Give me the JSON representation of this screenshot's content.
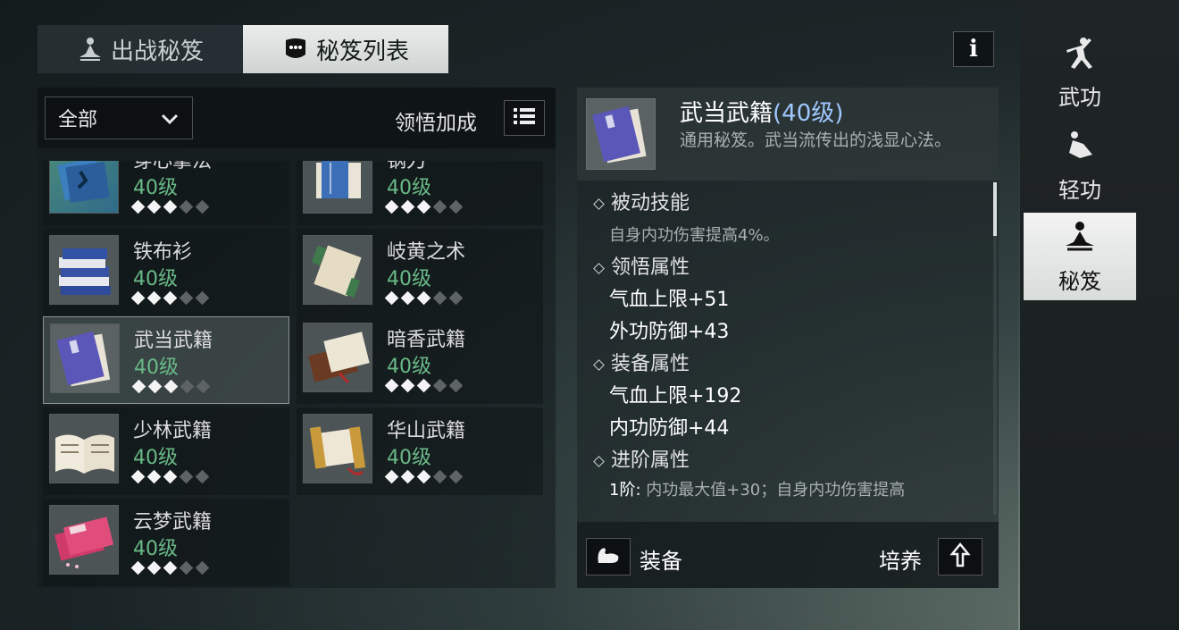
{
  "top_tabs": [
    {
      "label": "出战秘笈",
      "icon": "meditation-icon",
      "active": false
    },
    {
      "label": "秘笈列表",
      "icon": "book-mask-icon",
      "active": true
    }
  ],
  "info_button": {
    "label": "i"
  },
  "filter": {
    "dropdown_value": "全部",
    "enlight_label": "领悟加成"
  },
  "cards": [
    {
      "name": "穿心掌法",
      "level": "40级",
      "stars": 3,
      "max_stars": 5,
      "book": "blue-figure",
      "cut": true
    },
    {
      "name": "钢刀",
      "level": "40级",
      "stars": 3,
      "max_stars": 5,
      "book": "blue-open",
      "cut": true
    },
    {
      "name": "铁布衫",
      "level": "40级",
      "stars": 3,
      "max_stars": 5,
      "book": "blue-stack"
    },
    {
      "name": "岐黄之术",
      "level": "40级",
      "stars": 3,
      "max_stars": 5,
      "book": "scroll-green"
    },
    {
      "name": "武当武籍",
      "level": "40级",
      "stars": 3,
      "max_stars": 5,
      "book": "purple",
      "selected": true
    },
    {
      "name": "暗香武籍",
      "level": "40级",
      "stars": 3,
      "max_stars": 5,
      "book": "brown-open"
    },
    {
      "name": "少林武籍",
      "level": "40级",
      "stars": 3,
      "max_stars": 5,
      "book": "white-open"
    },
    {
      "name": "华山武籍",
      "level": "40级",
      "stars": 3,
      "max_stars": 5,
      "book": "scroll-gold"
    },
    {
      "name": "云梦武籍",
      "level": "40级",
      "stars": 3,
      "max_stars": 5,
      "book": "pink"
    }
  ],
  "detail": {
    "title": "武当武籍",
    "level": "(40级)",
    "description": "通用秘笈。武当流传出的浅显心法。",
    "sections": [
      {
        "heading": "被动技能",
        "lines": [
          {
            "text": "自身内功伤害提高4%。",
            "style": "sub"
          }
        ]
      },
      {
        "heading": "领悟属性",
        "lines": [
          {
            "text": "气血上限+51",
            "style": "val"
          },
          {
            "text": "外功防御+43",
            "style": "val"
          }
        ]
      },
      {
        "heading": "装备属性",
        "lines": [
          {
            "text": "气血上限+192",
            "style": "val"
          },
          {
            "text": "内功防御+44",
            "style": "val"
          }
        ]
      },
      {
        "heading": "进阶属性",
        "lines": []
      }
    ],
    "advance_line": {
      "prefix": "1阶:",
      "text": "内功最大值+30；自身内功伤害提高"
    },
    "equip_label": "装备",
    "train_label": "培养"
  },
  "side_nav": [
    {
      "label": "武功",
      "icon": "martial-figure-icon",
      "active": false
    },
    {
      "label": "轻功",
      "icon": "flying-figure-icon",
      "active": false
    },
    {
      "label": "秘笈",
      "icon": "meditation-icon",
      "active": true
    }
  ],
  "colors": {
    "level_green": "#69b987",
    "accent_blue": "#9fc8ff"
  }
}
